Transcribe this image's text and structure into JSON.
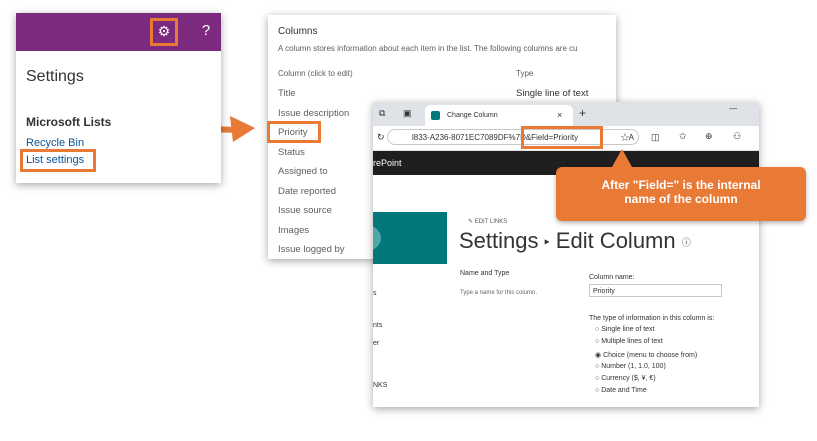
{
  "settings_panel": {
    "gear": "⚙",
    "help": "?",
    "title": "Settings",
    "subtitle": "Microsoft Lists",
    "links": [
      "Recycle Bin",
      "List settings"
    ],
    "header_color": "#7b2a7e"
  },
  "columns_panel": {
    "heading": "Columns",
    "description": "A column stores information about each item in the list. The following columns are cu",
    "col_header_name": "Column (click to edit)",
    "col_header_type": "Type",
    "rows": [
      "Title",
      "Issue description",
      "Priority",
      "Status",
      "Assigned to",
      "Date reported",
      "Issue source",
      "Images",
      "Issue logged by"
    ],
    "first_row_type": "Single line of text"
  },
  "browser": {
    "tab_title": "Change Column",
    "tab_close": "×",
    "new_tab": "+",
    "minimize": "—",
    "url": "l833-A236-8071EC7089DF%7D&Field=Priority",
    "url_suffix": "A",
    "sharepoint_label": "rePoint",
    "edit_links": "EDIT LINKS",
    "page_title_1": "Settings",
    "page_title_sep": "▸",
    "page_title_2": "Edit Column",
    "name_type_heading": "Name and Type",
    "name_type_hint": "Type a name for this column.",
    "column_name_label": "Column name:",
    "column_name_value": "Priority",
    "type_label": "The type of information in this column is:",
    "type_options": [
      {
        "label": "Single line of text",
        "selected": false
      },
      {
        "label": "Multiple lines of text",
        "selected": false
      },
      {
        "label": "Choice (menu to choose from)",
        "selected": true
      },
      {
        "label": "Number (1, 1.0, 100)",
        "selected": false
      },
      {
        "label": "Currency ($, ¥, €)",
        "selected": false
      },
      {
        "label": "Date and Time",
        "selected": false
      }
    ],
    "left_nav_fragments": [
      "s",
      "nts",
      "er",
      "NKS"
    ],
    "accent": "#03787c"
  },
  "callout": {
    "line1": "After \"Field=\" is the internal",
    "line2": "name of the column",
    "color": "#e87a36"
  }
}
